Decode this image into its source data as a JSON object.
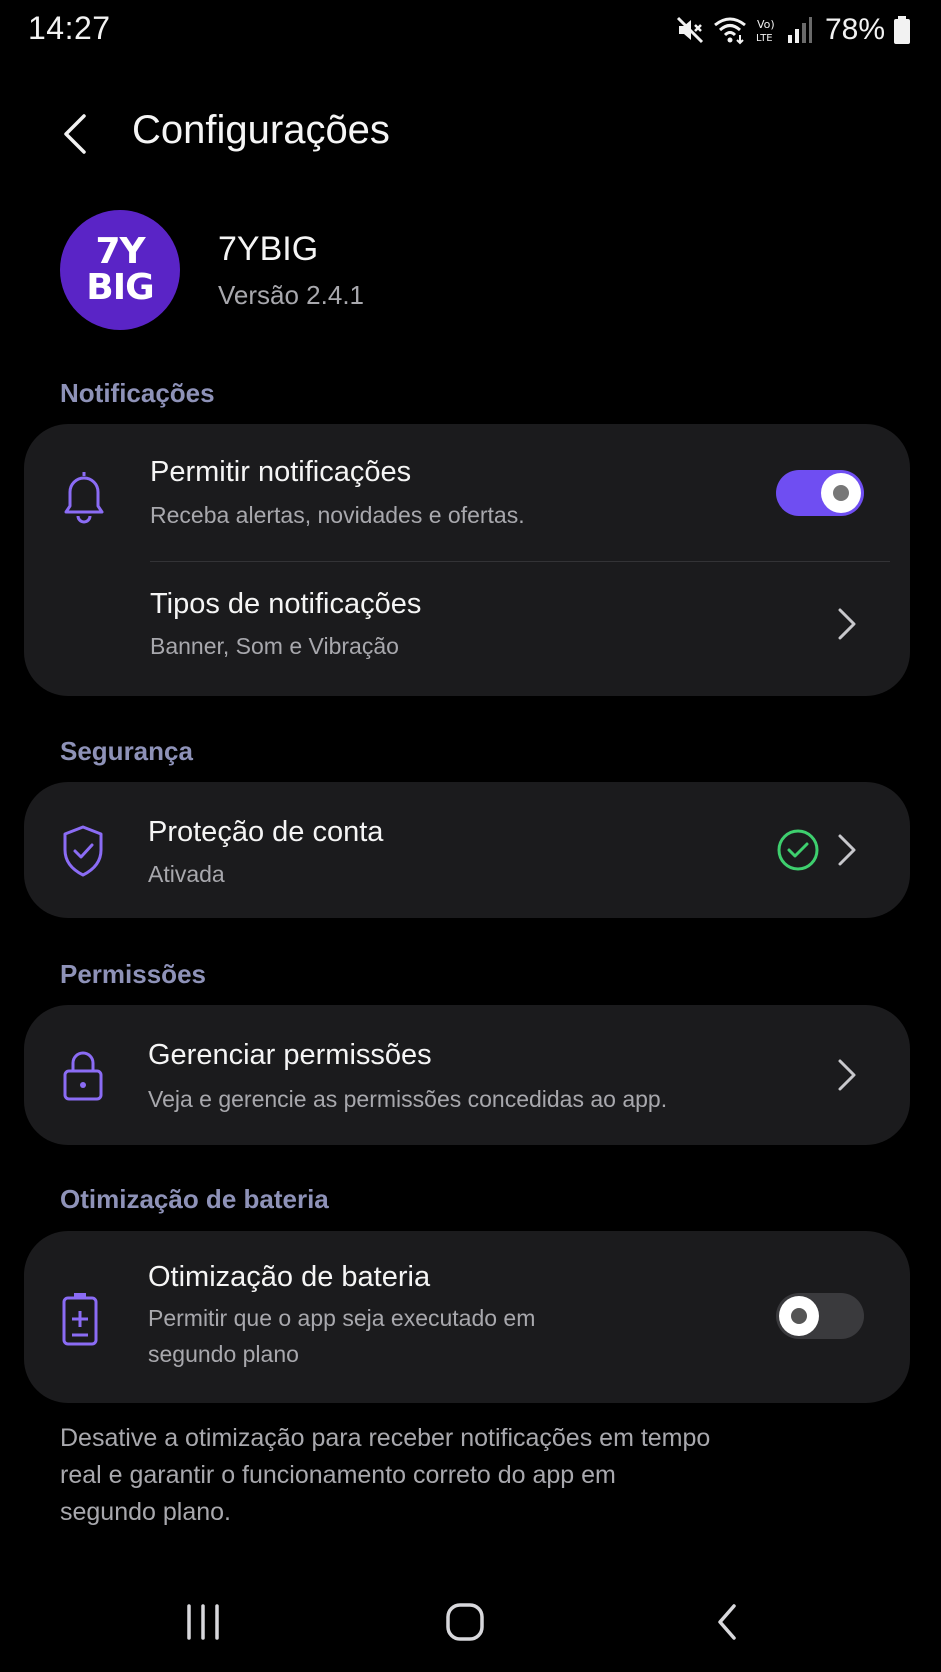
{
  "status_bar": {
    "time": "14:27",
    "battery_percent": "78%",
    "icons": [
      "mute-icon",
      "wifi-icon",
      "volte-icon",
      "signal-icon",
      "battery-icon"
    ]
  },
  "header": {
    "title": "Configurações",
    "back_icon": "chevron-left-icon"
  },
  "app": {
    "logo_line1": "7Y",
    "logo_line2": "BIG",
    "name": "7YBIG",
    "version": "Versão 2.4.1",
    "brand_color": "#5a24c6"
  },
  "sections": {
    "notifications": {
      "title": "Notificações",
      "allow": {
        "title": "Permitir notificações",
        "subtitle": "Receba alertas, novidades e ofertas.",
        "enabled": true,
        "icon": "bell-icon"
      },
      "types": {
        "title": "Tipos de notificações",
        "subtitle": "Banner, Som e Vibração"
      }
    },
    "security": {
      "title": "Segurança",
      "protection": {
        "title": "Proteção de conta",
        "subtitle": "Ativada",
        "icon": "shield-check-icon",
        "status_icon": "check-circle-icon"
      }
    },
    "permissions": {
      "title": "Permissões",
      "manage": {
        "title": "Gerenciar permissões",
        "subtitle": "Veja e gerencie as permissões concedidas ao app.",
        "icon": "lock-icon"
      }
    },
    "battery": {
      "title": "Otimização de bateria",
      "optimization": {
        "title": "Otimização de bateria",
        "subtitle_line1": "Permitir que o app seja executado em",
        "subtitle_line2": "segundo plano",
        "enabled": false,
        "icon": "battery-plus-icon"
      },
      "note_line1": "Desative a otimização para receber notificações em tempo",
      "note_line2": "real e garantir o funcionamento correto do app em",
      "note_line3": "segundo plano."
    }
  },
  "colors": {
    "accent": "#6f4ef2",
    "icon_purple": "#8b6cf5",
    "success_green": "#3ecf6e",
    "section_title": "#8e92b8",
    "card_bg": "#1b1b1d"
  },
  "nav_bar": {
    "recents_icon": "recents-icon",
    "home_icon": "home-icon",
    "back_icon": "back-icon"
  }
}
